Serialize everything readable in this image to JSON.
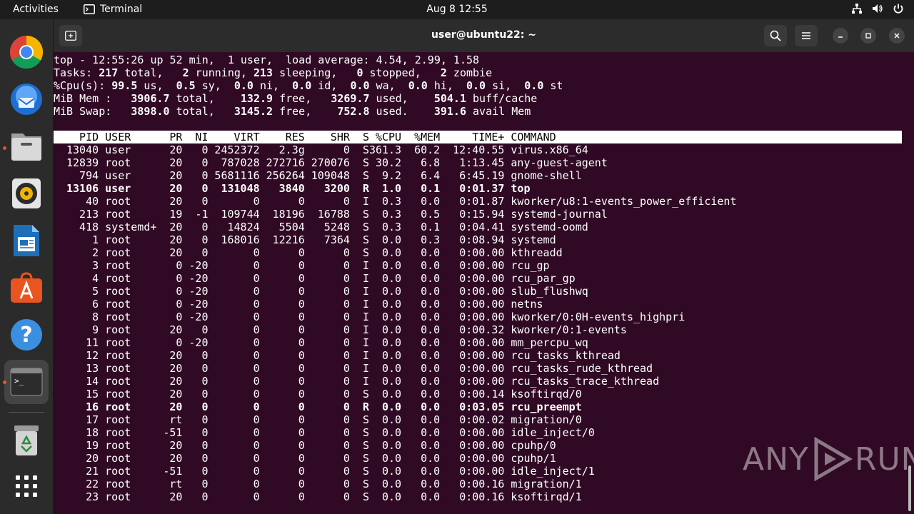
{
  "topbar": {
    "activities": "Activities",
    "app_name": "Terminal",
    "clock": "Aug 8  12:55"
  },
  "dock": {
    "items": [
      "Google Chrome",
      "Thunderbird Mail",
      "Files",
      "Rhythmbox",
      "LibreOffice Writer",
      "Ubuntu Software",
      "Help",
      "Terminal",
      "Trash",
      "Show Applications"
    ]
  },
  "window": {
    "title": "user@ubuntu22: ~"
  },
  "top": {
    "summary": [
      [
        {
          "t": "top - 12:55:26 up 52 min,  1 user,  load average: 4.54, 2.99, 1.58",
          "b": false
        }
      ],
      [
        {
          "t": "Tasks: ",
          "b": false
        },
        {
          "t": "217",
          "b": true
        },
        {
          "t": " total,   ",
          "b": false
        },
        {
          "t": "2",
          "b": true
        },
        {
          "t": " running, ",
          "b": false
        },
        {
          "t": "213",
          "b": true
        },
        {
          "t": " sleeping,   ",
          "b": false
        },
        {
          "t": "0",
          "b": true
        },
        {
          "t": " stopped,   ",
          "b": false
        },
        {
          "t": "2",
          "b": true
        },
        {
          "t": " zombie",
          "b": false
        }
      ],
      [
        {
          "t": "%Cpu(s): ",
          "b": false
        },
        {
          "t": "99.5",
          "b": true
        },
        {
          "t": " us,  ",
          "b": false
        },
        {
          "t": "0.5",
          "b": true
        },
        {
          "t": " sy,  ",
          "b": false
        },
        {
          "t": "0.0",
          "b": true
        },
        {
          "t": " ni,  ",
          "b": false
        },
        {
          "t": "0.0",
          "b": true
        },
        {
          "t": " id,  ",
          "b": false
        },
        {
          "t": "0.0",
          "b": true
        },
        {
          "t": " wa,  ",
          "b": false
        },
        {
          "t": "0.0",
          "b": true
        },
        {
          "t": " hi,  ",
          "b": false
        },
        {
          "t": "0.0",
          "b": true
        },
        {
          "t": " si,  ",
          "b": false
        },
        {
          "t": "0.0",
          "b": true
        },
        {
          "t": " st",
          "b": false
        }
      ],
      [
        {
          "t": "MiB Mem :   ",
          "b": false
        },
        {
          "t": "3906.7",
          "b": true
        },
        {
          "t": " total,    ",
          "b": false
        },
        {
          "t": "132.9",
          "b": true
        },
        {
          "t": " free,   ",
          "b": false
        },
        {
          "t": "3269.7",
          "b": true
        },
        {
          "t": " used,    ",
          "b": false
        },
        {
          "t": "504.1",
          "b": true
        },
        {
          "t": " buff/cache",
          "b": false
        }
      ],
      [
        {
          "t": "MiB Swap:   ",
          "b": false
        },
        {
          "t": "3898.0",
          "b": true
        },
        {
          "t": " total,   ",
          "b": false
        },
        {
          "t": "3145.2",
          "b": true
        },
        {
          "t": " free,    ",
          "b": false
        },
        {
          "t": "752.8",
          "b": true
        },
        {
          "t": " used.    ",
          "b": false
        },
        {
          "t": "391.6",
          "b": true
        },
        {
          "t": " avail Mem",
          "b": false
        }
      ]
    ],
    "columns": [
      "PID",
      "USER",
      "PR",
      "NI",
      "VIRT",
      "RES",
      "SHR",
      "S",
      "%CPU",
      "%MEM",
      "TIME+",
      "COMMAND"
    ],
    "processes": [
      {
        "pid": "13040",
        "user": "user",
        "pr": "20",
        "ni": "0",
        "virt": "2452372",
        "res": "2.3g",
        "shr": "0",
        "s": "S",
        "cpu": "361.3",
        "mem": "60.2",
        "time": "12:40.55",
        "cmd": "virus.x86_64",
        "bold": false
      },
      {
        "pid": "12839",
        "user": "root",
        "pr": "20",
        "ni": "0",
        "virt": "787028",
        "res": "272716",
        "shr": "270076",
        "s": "S",
        "cpu": "30.2",
        "mem": "6.8",
        "time": "1:13.45",
        "cmd": "any-guest-agent",
        "bold": false
      },
      {
        "pid": "794",
        "user": "user",
        "pr": "20",
        "ni": "0",
        "virt": "5681116",
        "res": "256264",
        "shr": "109048",
        "s": "S",
        "cpu": "9.2",
        "mem": "6.4",
        "time": "6:45.19",
        "cmd": "gnome-shell",
        "bold": false
      },
      {
        "pid": "13106",
        "user": "user",
        "pr": "20",
        "ni": "0",
        "virt": "131048",
        "res": "3840",
        "shr": "3200",
        "s": "R",
        "cpu": "1.0",
        "mem": "0.1",
        "time": "0:01.37",
        "cmd": "top",
        "bold": true
      },
      {
        "pid": "40",
        "user": "root",
        "pr": "20",
        "ni": "0",
        "virt": "0",
        "res": "0",
        "shr": "0",
        "s": "I",
        "cpu": "0.3",
        "mem": "0.0",
        "time": "0:01.87",
        "cmd": "kworker/u8:1-events_power_efficient",
        "bold": false
      },
      {
        "pid": "213",
        "user": "root",
        "pr": "19",
        "ni": "-1",
        "virt": "109744",
        "res": "18196",
        "shr": "16788",
        "s": "S",
        "cpu": "0.3",
        "mem": "0.5",
        "time": "0:15.94",
        "cmd": "systemd-journal",
        "bold": false
      },
      {
        "pid": "418",
        "user": "systemd+",
        "pr": "20",
        "ni": "0",
        "virt": "14824",
        "res": "5504",
        "shr": "5248",
        "s": "S",
        "cpu": "0.3",
        "mem": "0.1",
        "time": "0:04.41",
        "cmd": "systemd-oomd",
        "bold": false
      },
      {
        "pid": "1",
        "user": "root",
        "pr": "20",
        "ni": "0",
        "virt": "168016",
        "res": "12216",
        "shr": "7364",
        "s": "S",
        "cpu": "0.0",
        "mem": "0.3",
        "time": "0:08.94",
        "cmd": "systemd",
        "bold": false
      },
      {
        "pid": "2",
        "user": "root",
        "pr": "20",
        "ni": "0",
        "virt": "0",
        "res": "0",
        "shr": "0",
        "s": "S",
        "cpu": "0.0",
        "mem": "0.0",
        "time": "0:00.00",
        "cmd": "kthreadd",
        "bold": false
      },
      {
        "pid": "3",
        "user": "root",
        "pr": "0",
        "ni": "-20",
        "virt": "0",
        "res": "0",
        "shr": "0",
        "s": "I",
        "cpu": "0.0",
        "mem": "0.0",
        "time": "0:00.00",
        "cmd": "rcu_gp",
        "bold": false
      },
      {
        "pid": "4",
        "user": "root",
        "pr": "0",
        "ni": "-20",
        "virt": "0",
        "res": "0",
        "shr": "0",
        "s": "I",
        "cpu": "0.0",
        "mem": "0.0",
        "time": "0:00.00",
        "cmd": "rcu_par_gp",
        "bold": false
      },
      {
        "pid": "5",
        "user": "root",
        "pr": "0",
        "ni": "-20",
        "virt": "0",
        "res": "0",
        "shr": "0",
        "s": "I",
        "cpu": "0.0",
        "mem": "0.0",
        "time": "0:00.00",
        "cmd": "slub_flushwq",
        "bold": false
      },
      {
        "pid": "6",
        "user": "root",
        "pr": "0",
        "ni": "-20",
        "virt": "0",
        "res": "0",
        "shr": "0",
        "s": "I",
        "cpu": "0.0",
        "mem": "0.0",
        "time": "0:00.00",
        "cmd": "netns",
        "bold": false
      },
      {
        "pid": "8",
        "user": "root",
        "pr": "0",
        "ni": "-20",
        "virt": "0",
        "res": "0",
        "shr": "0",
        "s": "I",
        "cpu": "0.0",
        "mem": "0.0",
        "time": "0:00.00",
        "cmd": "kworker/0:0H-events_highpri",
        "bold": false
      },
      {
        "pid": "9",
        "user": "root",
        "pr": "20",
        "ni": "0",
        "virt": "0",
        "res": "0",
        "shr": "0",
        "s": "I",
        "cpu": "0.0",
        "mem": "0.0",
        "time": "0:00.32",
        "cmd": "kworker/0:1-events",
        "bold": false
      },
      {
        "pid": "11",
        "user": "root",
        "pr": "0",
        "ni": "-20",
        "virt": "0",
        "res": "0",
        "shr": "0",
        "s": "I",
        "cpu": "0.0",
        "mem": "0.0",
        "time": "0:00.00",
        "cmd": "mm_percpu_wq",
        "bold": false
      },
      {
        "pid": "12",
        "user": "root",
        "pr": "20",
        "ni": "0",
        "virt": "0",
        "res": "0",
        "shr": "0",
        "s": "I",
        "cpu": "0.0",
        "mem": "0.0",
        "time": "0:00.00",
        "cmd": "rcu_tasks_kthread",
        "bold": false
      },
      {
        "pid": "13",
        "user": "root",
        "pr": "20",
        "ni": "0",
        "virt": "0",
        "res": "0",
        "shr": "0",
        "s": "I",
        "cpu": "0.0",
        "mem": "0.0",
        "time": "0:00.00",
        "cmd": "rcu_tasks_rude_kthread",
        "bold": false
      },
      {
        "pid": "14",
        "user": "root",
        "pr": "20",
        "ni": "0",
        "virt": "0",
        "res": "0",
        "shr": "0",
        "s": "I",
        "cpu": "0.0",
        "mem": "0.0",
        "time": "0:00.00",
        "cmd": "rcu_tasks_trace_kthread",
        "bold": false
      },
      {
        "pid": "15",
        "user": "root",
        "pr": "20",
        "ni": "0",
        "virt": "0",
        "res": "0",
        "shr": "0",
        "s": "S",
        "cpu": "0.0",
        "mem": "0.0",
        "time": "0:00.14",
        "cmd": "ksoftirqd/0",
        "bold": false
      },
      {
        "pid": "16",
        "user": "root",
        "pr": "20",
        "ni": "0",
        "virt": "0",
        "res": "0",
        "shr": "0",
        "s": "R",
        "cpu": "0.0",
        "mem": "0.0",
        "time": "0:03.05",
        "cmd": "rcu_preempt",
        "bold": true
      },
      {
        "pid": "17",
        "user": "root",
        "pr": "rt",
        "ni": "0",
        "virt": "0",
        "res": "0",
        "shr": "0",
        "s": "S",
        "cpu": "0.0",
        "mem": "0.0",
        "time": "0:00.02",
        "cmd": "migration/0",
        "bold": false
      },
      {
        "pid": "18",
        "user": "root",
        "pr": "-51",
        "ni": "0",
        "virt": "0",
        "res": "0",
        "shr": "0",
        "s": "S",
        "cpu": "0.0",
        "mem": "0.0",
        "time": "0:00.00",
        "cmd": "idle_inject/0",
        "bold": false
      },
      {
        "pid": "19",
        "user": "root",
        "pr": "20",
        "ni": "0",
        "virt": "0",
        "res": "0",
        "shr": "0",
        "s": "S",
        "cpu": "0.0",
        "mem": "0.0",
        "time": "0:00.00",
        "cmd": "cpuhp/0",
        "bold": false
      },
      {
        "pid": "20",
        "user": "root",
        "pr": "20",
        "ni": "0",
        "virt": "0",
        "res": "0",
        "shr": "0",
        "s": "S",
        "cpu": "0.0",
        "mem": "0.0",
        "time": "0:00.00",
        "cmd": "cpuhp/1",
        "bold": false
      },
      {
        "pid": "21",
        "user": "root",
        "pr": "-51",
        "ni": "0",
        "virt": "0",
        "res": "0",
        "shr": "0",
        "s": "S",
        "cpu": "0.0",
        "mem": "0.0",
        "time": "0:00.00",
        "cmd": "idle_inject/1",
        "bold": false
      },
      {
        "pid": "22",
        "user": "root",
        "pr": "rt",
        "ni": "0",
        "virt": "0",
        "res": "0",
        "shr": "0",
        "s": "S",
        "cpu": "0.0",
        "mem": "0.0",
        "time": "0:00.16",
        "cmd": "migration/1",
        "bold": false
      },
      {
        "pid": "23",
        "user": "root",
        "pr": "20",
        "ni": "0",
        "virt": "0",
        "res": "0",
        "shr": "0",
        "s": "S",
        "cpu": "0.0",
        "mem": "0.0",
        "time": "0:00.16",
        "cmd": "ksoftirqd/1",
        "bold": false
      }
    ]
  },
  "watermark": {
    "left": "ANY",
    "right": "RUN"
  },
  "colors": {
    "terminal_bg": "#300a24",
    "accent": "#e95420",
    "topbar_bg": "#1d1d1d",
    "dock_bg": "#2b2b2b"
  }
}
